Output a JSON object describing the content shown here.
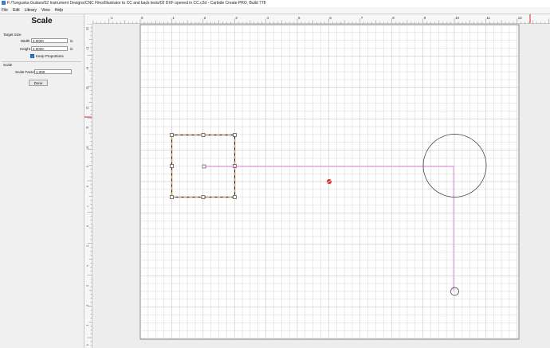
{
  "window": {
    "title": "F:/Tunguska Guitars/02 Instrument Designs/CNC Files/Illustrator to CC and back tests/02 DXF opened in CC.c2d - Carbide Create PRO, Build 778"
  },
  "menu": [
    "File",
    "Edit",
    "Library",
    "View",
    "Help"
  ],
  "panel": {
    "title": "Scale",
    "target_size_label": "Target Size",
    "width_label": "Width",
    "width_value": "2.0000",
    "height_label": "Height",
    "height_value": "2.0000",
    "unit": "in",
    "keep_proportions_label": "Keep Proportions",
    "keep_proportions_checked": true,
    "scale_label": "Scale",
    "scale_factor_label": "Scale Factor",
    "scale_factor_value": "1.000",
    "done_label": "Done"
  },
  "ruler": {
    "top_labels": [
      "-1",
      "0",
      "1",
      "2",
      "3",
      "4",
      "5",
      "6",
      "7",
      "8",
      "9",
      "10",
      "11",
      "12"
    ],
    "left_labels": [
      "16",
      "15",
      "14",
      "13",
      "12",
      "11",
      "10",
      "9",
      "8",
      "7",
      "6",
      "5",
      "4",
      "3",
      "2",
      "1",
      "0"
    ]
  },
  "colors": {
    "selection": "#d4a24a",
    "toolpath": "#e58ae5",
    "origin": "#e02020",
    "grid": "#d6d6d6",
    "grid_major": "#bdbdbd",
    "accent_marker": "#e02020"
  }
}
